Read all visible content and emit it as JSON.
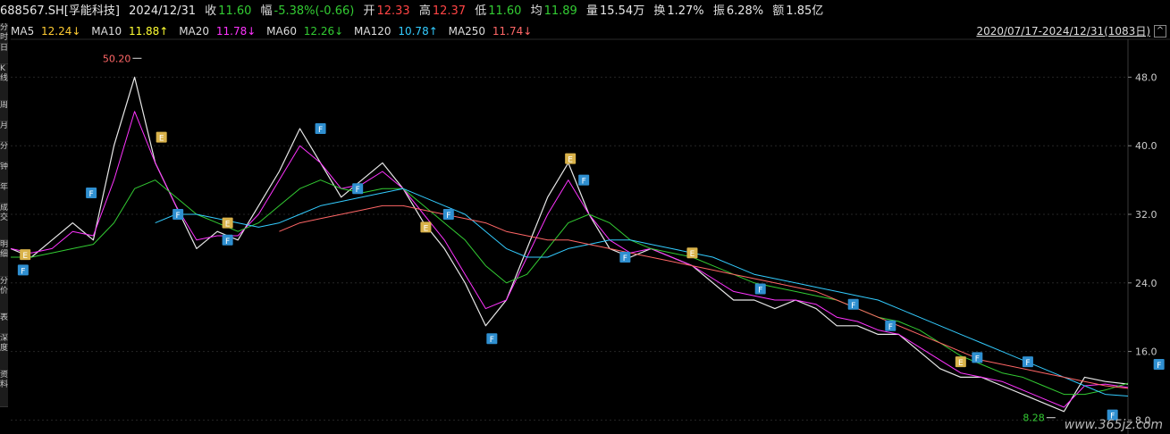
{
  "header": {
    "code": "688567.SH[孚能科技]",
    "date": "2024/12/31",
    "close_label": "收",
    "close": "11.60",
    "amp_label": "幅",
    "amp": "-5.38%(-0.66)",
    "open_label": "开",
    "open": "12.33",
    "high_label": "高",
    "high": "12.37",
    "low_label": "低",
    "low": "11.60",
    "avg_label": "均",
    "avg": "11.89",
    "vol_label": "量",
    "vol": "15.54万",
    "turnover_label": "换",
    "turnover": "1.27%",
    "swing_label": "振",
    "swing": "6.28%",
    "amount_label": "额",
    "amount": "1.85亿"
  },
  "ma_legend": [
    {
      "name": "MA5",
      "value": "12.24↓",
      "color": "#e8e8e8",
      "vcolor": "#ffcc33"
    },
    {
      "name": "MA10",
      "value": "11.88↑",
      "color": "#e8e8e8",
      "vcolor": "#ffff33"
    },
    {
      "name": "MA20",
      "value": "11.78↓",
      "color": "#e8e8e8",
      "vcolor": "#ff33ff"
    },
    {
      "name": "MA60",
      "value": "12.26↓",
      "color": "#e8e8e8",
      "vcolor": "#33cc33"
    },
    {
      "name": "MA120",
      "value": "10.78↑",
      "color": "#e8e8e8",
      "vcolor": "#33ccff"
    },
    {
      "name": "MA250",
      "value": "11.74↓",
      "color": "#e8e8e8",
      "vcolor": "#ff6666"
    }
  ],
  "range_label": "2020/07/17-2024/12/31(1083日)",
  "collapse_icon": "^",
  "left_tabs": [
    "分时",
    "日",
    "K线",
    "周",
    "月",
    "分",
    "钟",
    "年",
    "成交",
    "明细",
    "分价",
    "表",
    "深度",
    "资料"
  ],
  "watermark": "www.365jz.com",
  "chart_data": {
    "type": "line",
    "title": "",
    "xlabel": "",
    "ylabel": "",
    "ylim": [
      7.0,
      52.0
    ],
    "yticks": [
      "48.0",
      "40.0",
      "32.0",
      "24.0",
      "16.0",
      "8.0"
    ],
    "ytick_values": [
      48,
      40,
      32,
      24,
      16,
      8
    ],
    "x": [
      0,
      20,
      40,
      60,
      80,
      100,
      120,
      140,
      160,
      180,
      200,
      220,
      240,
      260,
      280,
      300,
      320,
      340,
      360,
      380,
      400,
      420,
      440,
      460,
      480,
      500,
      520,
      540,
      560,
      580,
      600,
      620,
      640,
      660,
      680,
      700,
      720,
      740,
      760,
      780,
      800,
      820,
      840,
      860,
      880,
      900,
      920,
      940,
      960,
      980,
      1000,
      1020,
      1040,
      1060,
      1082
    ],
    "series": [
      {
        "name": "MA5",
        "color": "#e8e8e8",
        "values": [
          28,
          27,
          29,
          31,
          29,
          40,
          48,
          38,
          33,
          28,
          30,
          29,
          33,
          37,
          42,
          38,
          34,
          36,
          38,
          35,
          31,
          28,
          24,
          19,
          22,
          28,
          34,
          38,
          32,
          28,
          27,
          28,
          27,
          26,
          24,
          22,
          22,
          21,
          22,
          21,
          19,
          19,
          18,
          18,
          16,
          14,
          13,
          13,
          12,
          11,
          10,
          9,
          13,
          12.5,
          12.2
        ]
      },
      {
        "name": "MA20",
        "color": "#ff33ff",
        "values": [
          28,
          27.5,
          28,
          30,
          29.5,
          36,
          44,
          38,
          33,
          29,
          29.5,
          29.5,
          32,
          36,
          40,
          38,
          35,
          35.5,
          37,
          35,
          32,
          29,
          25,
          21,
          22,
          27,
          32,
          36,
          32,
          29,
          27.5,
          28,
          27,
          26,
          24.5,
          23,
          22.5,
          22,
          22,
          21.5,
          20,
          19.5,
          18.5,
          18,
          16.5,
          15,
          13.5,
          13,
          12.5,
          11.5,
          10.5,
          9.5,
          12,
          12.2,
          11.8
        ]
      },
      {
        "name": "MA60",
        "color": "#33cc33",
        "values": [
          27,
          27,
          27.5,
          28,
          28.5,
          31,
          35,
          36,
          34,
          32,
          31,
          30,
          31,
          33,
          35,
          36,
          35,
          34.5,
          35,
          35,
          33,
          31,
          29,
          26,
          24,
          25,
          28,
          31,
          32,
          31,
          29,
          28,
          27.5,
          27,
          26,
          25,
          24,
          23.5,
          23,
          22.5,
          22,
          21,
          20,
          19.5,
          18.5,
          17,
          15.5,
          14.5,
          13.5,
          13,
          12,
          11,
          11,
          11.5,
          12.3
        ]
      },
      {
        "name": "MA120",
        "color": "#33ccff",
        "values": [
          null,
          null,
          null,
          null,
          null,
          null,
          null,
          31,
          32,
          32,
          31.5,
          31,
          30.5,
          31,
          32,
          33,
          33.5,
          34,
          34.5,
          35,
          34,
          33,
          32,
          30,
          28,
          27,
          27,
          28,
          28.5,
          29,
          29,
          28.5,
          28,
          27.5,
          27,
          26,
          25,
          24.5,
          24,
          23.5,
          23,
          22.5,
          22,
          21,
          20,
          19,
          18,
          17,
          16,
          15,
          14,
          13,
          12,
          11,
          10.8
        ]
      },
      {
        "name": "MA250",
        "color": "#ff6666",
        "values": [
          null,
          null,
          null,
          null,
          null,
          null,
          null,
          null,
          null,
          null,
          null,
          null,
          null,
          30,
          31,
          31.5,
          32,
          32.5,
          33,
          33,
          32.5,
          32,
          31.5,
          31,
          30,
          29.5,
          29,
          29,
          28.5,
          28,
          27.5,
          27,
          26.5,
          26,
          25.5,
          25,
          24.5,
          24,
          23.5,
          23,
          22,
          21,
          20,
          19,
          18,
          17,
          16,
          15,
          14.5,
          14,
          13.5,
          13,
          12.5,
          12,
          11.7
        ]
      }
    ],
    "annotations": [
      {
        "text": "50.20",
        "x": 125,
        "y": 50.2,
        "color": "#ff6666"
      },
      {
        "text": "8.28",
        "x": 1010,
        "y": 8.28,
        "color": "#33cc33"
      }
    ],
    "markers": [
      {
        "label": "F",
        "x": 12,
        "y": 25.5,
        "type": "F"
      },
      {
        "label": "E",
        "x": 14,
        "y": 27.3,
        "type": "E"
      },
      {
        "label": "F",
        "x": 78,
        "y": 34.5,
        "type": "F"
      },
      {
        "label": "E",
        "x": 146,
        "y": 41,
        "type": "E"
      },
      {
        "label": "F",
        "x": 162,
        "y": 32,
        "type": "F"
      },
      {
        "label": "E",
        "x": 210,
        "y": 31,
        "type": "E"
      },
      {
        "label": "F",
        "x": 210,
        "y": 29,
        "type": "F"
      },
      {
        "label": "F",
        "x": 300,
        "y": 42,
        "type": "F"
      },
      {
        "label": "F",
        "x": 336,
        "y": 35,
        "type": "F"
      },
      {
        "label": "E",
        "x": 402,
        "y": 30.5,
        "type": "E"
      },
      {
        "label": "F",
        "x": 424,
        "y": 32,
        "type": "F"
      },
      {
        "label": "F",
        "x": 466,
        "y": 17.5,
        "type": "F"
      },
      {
        "label": "E",
        "x": 542,
        "y": 38.5,
        "type": "E"
      },
      {
        "label": "F",
        "x": 555,
        "y": 36,
        "type": "F"
      },
      {
        "label": "F",
        "x": 595,
        "y": 27,
        "type": "F"
      },
      {
        "label": "E",
        "x": 660,
        "y": 27.5,
        "type": "E"
      },
      {
        "label": "F",
        "x": 726,
        "y": 23.3,
        "type": "F"
      },
      {
        "label": "F",
        "x": 816,
        "y": 21.5,
        "type": "F"
      },
      {
        "label": "F",
        "x": 852,
        "y": 19,
        "type": "F"
      },
      {
        "label": "E",
        "x": 920,
        "y": 14.8,
        "type": "E"
      },
      {
        "label": "F",
        "x": 936,
        "y": 15.3,
        "type": "F"
      },
      {
        "label": "F",
        "x": 985,
        "y": 14.8,
        "type": "F"
      },
      {
        "label": "F",
        "x": 1067,
        "y": 8.6,
        "type": "F"
      },
      {
        "label": "F",
        "x": 1112,
        "y": 14.5,
        "type": "F"
      },
      {
        "label": "F",
        "x": 1160,
        "y": 49.2,
        "type": "P"
      }
    ]
  }
}
